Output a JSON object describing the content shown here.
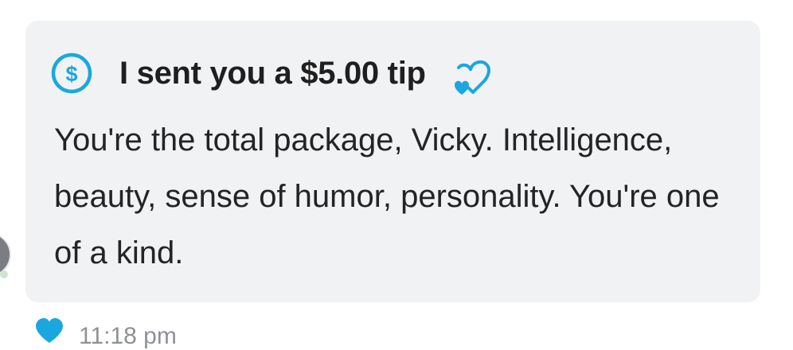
{
  "message": {
    "tip_title": "I sent you a $5.00 tip",
    "text": "You're the total package, Vicky. Intelligence, beauty, sense of humor, personality. You're one of a kind.",
    "timestamp": "11:18 pm"
  },
  "icons": {
    "tip": "dollar-circle-icon",
    "decoration": "two-hearts-outline-icon",
    "like": "heart-filled-icon"
  },
  "colors": {
    "accent": "#1aa7e0",
    "bubble_background": "#f1f2f4",
    "title_text": "#1f1f1f",
    "body_text": "#242424",
    "timestamp_text": "#8e9196"
  }
}
